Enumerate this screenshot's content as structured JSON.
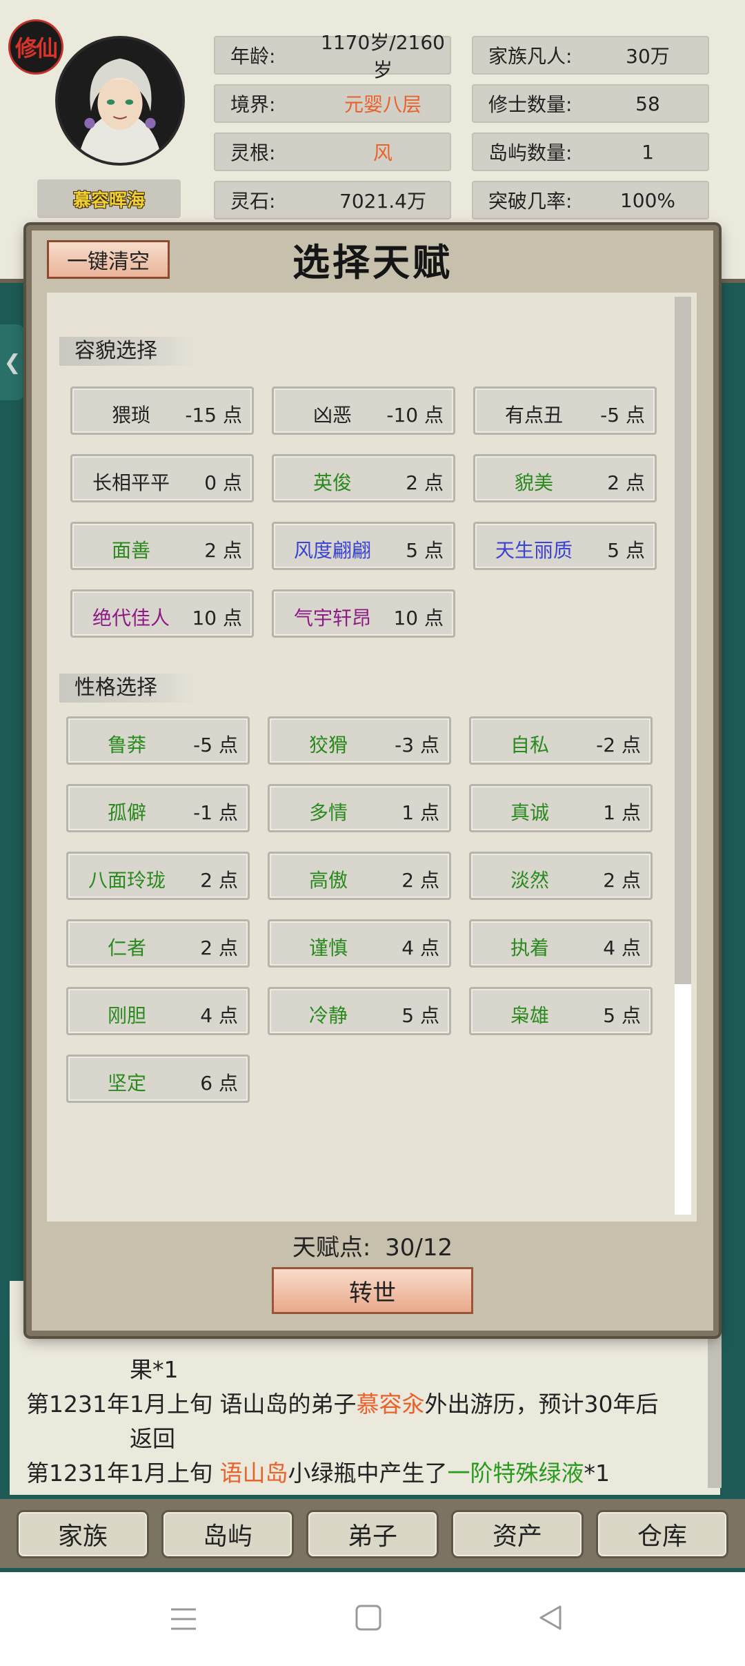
{
  "header": {
    "seal_text": "修仙",
    "character_name": "慕容晖海",
    "stats_left": [
      {
        "key": "年龄:",
        "value": "1170岁/2160岁",
        "color": "#222222"
      },
      {
        "key": "境界:",
        "value": "元婴八层",
        "color": "#e8622c"
      },
      {
        "key": "灵根:",
        "value": "风",
        "color": "#e8622c"
      },
      {
        "key": "灵石:",
        "value": "7021.4万",
        "color": "#222222"
      }
    ],
    "stats_right": [
      {
        "key": "家族凡人:",
        "value": "30万"
      },
      {
        "key": "修士数量:",
        "value": "58"
      },
      {
        "key": "岛屿数量:",
        "value": "1"
      },
      {
        "key": "突破几率:",
        "value": "100%"
      }
    ]
  },
  "modal": {
    "title": "选择天赋",
    "clear_button": "一键清空",
    "appearance_section": "容貌选择",
    "appearance": [
      {
        "name": "猥琐",
        "points": "-15 点",
        "color": "black"
      },
      {
        "name": "凶恶",
        "points": "-10 点",
        "color": "black"
      },
      {
        "name": "有点丑",
        "points": "-5 点",
        "color": "black"
      },
      {
        "name": "长相平平",
        "points": "0 点",
        "color": "black"
      },
      {
        "name": "英俊",
        "points": "2 点",
        "color": "green"
      },
      {
        "name": "貌美",
        "points": "2 点",
        "color": "green"
      },
      {
        "name": "面善",
        "points": "2 点",
        "color": "green"
      },
      {
        "name": "风度翩翩",
        "points": "5 点",
        "color": "blue"
      },
      {
        "name": "天生丽质",
        "points": "5 点",
        "color": "blue"
      },
      {
        "name": "绝代佳人",
        "points": "10 点",
        "color": "purple"
      },
      {
        "name": "气宇轩昂",
        "points": "10 点",
        "color": "purple"
      }
    ],
    "personality_section": "性格选择",
    "personality": [
      {
        "name": "鲁莽",
        "points": "-5 点",
        "color": "green"
      },
      {
        "name": "狡猾",
        "points": "-3 点",
        "color": "green"
      },
      {
        "name": "自私",
        "points": "-2 点",
        "color": "green"
      },
      {
        "name": "孤僻",
        "points": "-1 点",
        "color": "green"
      },
      {
        "name": "多情",
        "points": "1 点",
        "color": "green"
      },
      {
        "name": "真诚",
        "points": "1 点",
        "color": "green"
      },
      {
        "name": "八面玲珑",
        "points": "2 点",
        "color": "green"
      },
      {
        "name": "高傲",
        "points": "2 点",
        "color": "green"
      },
      {
        "name": "淡然",
        "points": "2 点",
        "color": "green"
      },
      {
        "name": "仁者",
        "points": "2 点",
        "color": "green"
      },
      {
        "name": "谨慎",
        "points": "4 点",
        "color": "green"
      },
      {
        "name": "执着",
        "points": "4 点",
        "color": "green"
      },
      {
        "name": "刚胆",
        "points": "4 点",
        "color": "green"
      },
      {
        "name": "冷静",
        "points": "5 点",
        "color": "green"
      },
      {
        "name": "枭雄",
        "points": "5 点",
        "color": "green"
      },
      {
        "name": "坚定",
        "points": "6 点",
        "color": "green"
      }
    ],
    "talent_points_label": "天赋点:",
    "talent_points_value": "30/12",
    "reincarnate_button": "转世"
  },
  "log": {
    "partial_line": "果*1",
    "lines": [
      {
        "year": "第1231年",
        "parts": [
          {
            "t": "1月上旬 语山岛的弟子",
            "c": ""
          },
          {
            "t": "慕容汆",
            "c": "o"
          },
          {
            "t": "外出游历，预计30年后",
            "c": ""
          }
        ]
      },
      {
        "year": "",
        "parts": [
          {
            "t": "返回",
            "c": ""
          }
        ]
      },
      {
        "year": "第1231年",
        "parts": [
          {
            "t": "1月上旬 ",
            "c": ""
          },
          {
            "t": "语山岛",
            "c": "o"
          },
          {
            "t": "小绿瓶中产生了",
            "c": ""
          },
          {
            "t": "一阶特殊绿液",
            "c": "g"
          },
          {
            "t": "*1",
            "c": ""
          }
        ]
      }
    ]
  },
  "nav": [
    "家族",
    "岛屿",
    "弟子",
    "资产",
    "仓库"
  ],
  "colors": {
    "accent_orange": "#e8622c",
    "green_text": "#2a8a1e",
    "blue_text": "#3b43d2",
    "purple_text": "#8e1a86"
  }
}
